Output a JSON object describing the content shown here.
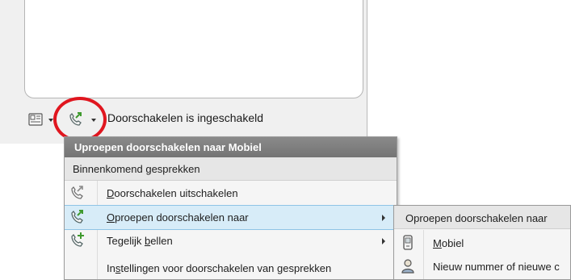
{
  "status_bar": {
    "status_text": "Doorschakelen is ingeschakeld",
    "icons": [
      "contact-card-icon",
      "call-forward-icon"
    ]
  },
  "context_menu": {
    "header": "Uproepen doorschakelen naar Mobiel",
    "section_title": "Binnenkomend gesprekken",
    "items": [
      {
        "label_u": "D",
        "label_rest": "oorschakelen uitschakelen",
        "icon": "phone-forward-icon",
        "has_submenu": false
      },
      {
        "label_u": "O",
        "label_rest": "proepen doorschakelen naar",
        "icon": "phone-forward-active-icon",
        "has_submenu": true,
        "highlighted": true
      },
      {
        "label_pre": "Tegelijk ",
        "label_u": "b",
        "label_rest": "ellen",
        "icon": "phone-add-icon",
        "has_submenu": true
      },
      {
        "label_pre": "In",
        "label_u": "s",
        "label_rest": "tellingen voor doorschakelen van gesprekken",
        "icon": "",
        "has_submenu": false
      }
    ]
  },
  "submenu": {
    "header": "Oproepen doorschakelen naar",
    "items": [
      {
        "label_u": "M",
        "label_rest": "obiel",
        "icon": "mobile-phone-icon"
      },
      {
        "label": "Nieuw nummer of nieuwe c",
        "icon": "contact-person-icon"
      }
    ]
  },
  "colors": {
    "highlight_circle": "#e0161f",
    "menu_header_bg": "#7e7e7e",
    "hover_bg": "#d7ecf8",
    "icon_green": "#3f9a2e"
  }
}
